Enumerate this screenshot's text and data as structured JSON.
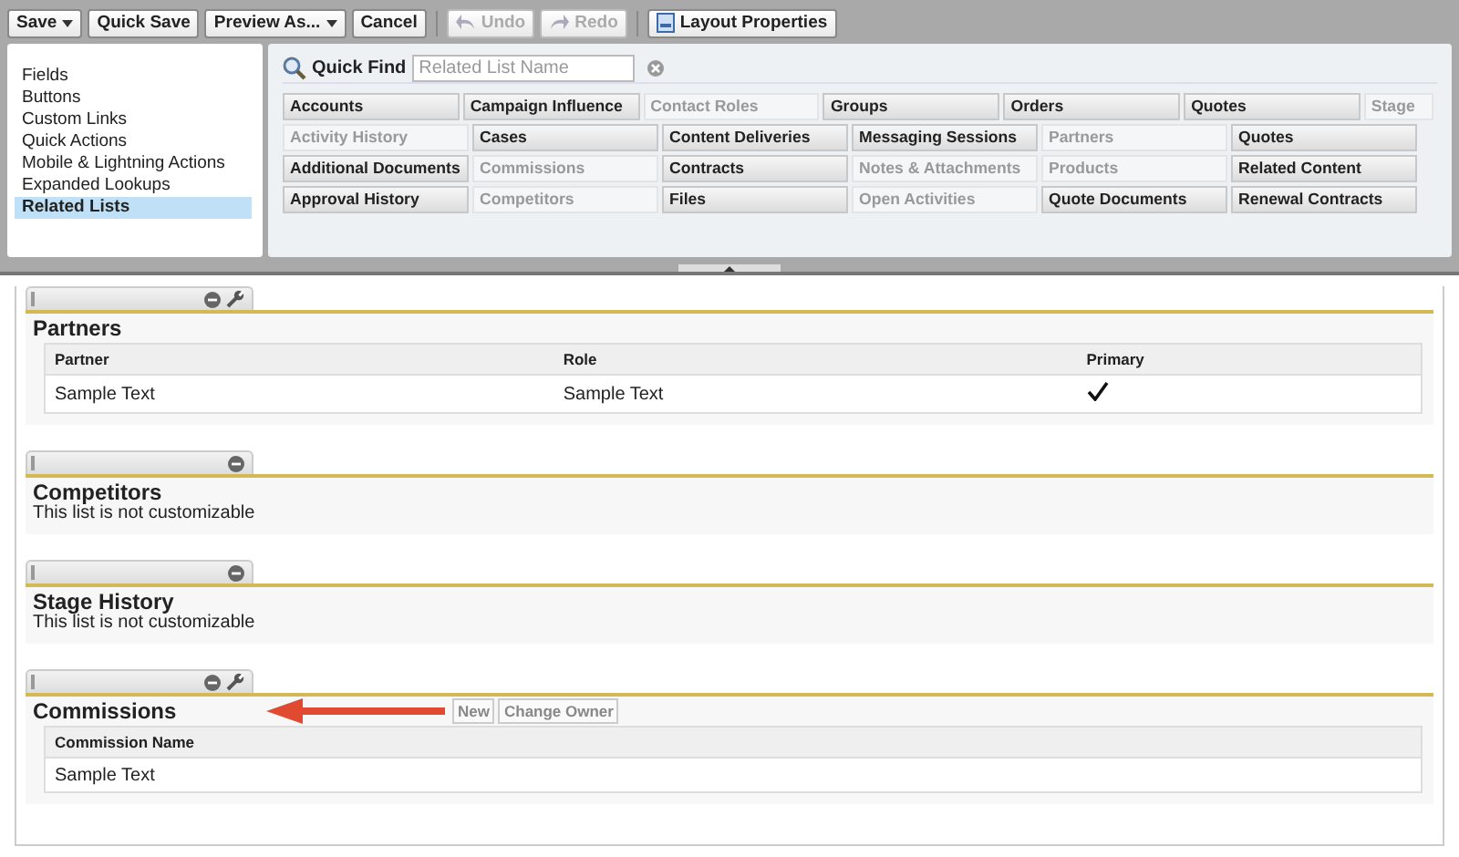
{
  "toolbar": {
    "buttons": [
      {
        "label": "Save",
        "kind": "dropdown",
        "disabled": false
      },
      {
        "label": "Quick Save",
        "kind": "plain",
        "disabled": false
      },
      {
        "label": "Preview As...",
        "kind": "dropdown",
        "disabled": false
      },
      {
        "label": "Cancel",
        "kind": "plain",
        "disabled": false
      },
      {
        "label": "Undo",
        "kind": "undo",
        "disabled": true
      },
      {
        "label": "Redo",
        "kind": "redo",
        "disabled": true
      },
      {
        "label": "Layout Properties",
        "kind": "properties",
        "disabled": false
      }
    ]
  },
  "sidebar": {
    "items": [
      {
        "label": "Fields",
        "selected": false
      },
      {
        "label": "Buttons",
        "selected": false
      },
      {
        "label": "Custom Links",
        "selected": false
      },
      {
        "label": "Quick Actions",
        "selected": false
      },
      {
        "label": "Mobile & Lightning Actions",
        "selected": false
      },
      {
        "label": "Expanded Lookups",
        "selected": false
      },
      {
        "label": "Related Lists",
        "selected": true
      }
    ]
  },
  "quick_find": {
    "label": "Quick Find",
    "placeholder": "Related List Name"
  },
  "palette": {
    "rows": [
      [
        {
          "label": "Accounts",
          "used": false
        },
        {
          "label": "Campaign Influence",
          "used": false
        },
        {
          "label": "Contact Roles",
          "used": true
        },
        {
          "label": "Groups",
          "used": false
        },
        {
          "label": "Orders",
          "used": false
        },
        {
          "label": "Quotes",
          "used": false
        },
        {
          "label": "Stage",
          "used": true
        }
      ],
      [
        {
          "label": "Activity History",
          "used": true
        },
        {
          "label": "Cases",
          "used": false
        },
        {
          "label": "Content Deliveries",
          "used": false
        },
        {
          "label": "Messaging Sessions",
          "used": false
        },
        {
          "label": "Partners",
          "used": true
        },
        {
          "label": "Quotes",
          "used": false
        }
      ],
      [
        {
          "label": "Additional Documents",
          "used": false
        },
        {
          "label": "Commissions",
          "used": true
        },
        {
          "label": "Contracts",
          "used": false
        },
        {
          "label": "Notes & Attachments",
          "used": true
        },
        {
          "label": "Products",
          "used": true
        },
        {
          "label": "Related Content",
          "used": false
        }
      ],
      [
        {
          "label": "Approval History",
          "used": false
        },
        {
          "label": "Competitors",
          "used": true
        },
        {
          "label": "Files",
          "used": false
        },
        {
          "label": "Open Activities",
          "used": true
        },
        {
          "label": "Quote Documents",
          "used": false
        },
        {
          "label": "Renewal Contracts",
          "used": false
        }
      ]
    ]
  },
  "sections": [
    {
      "title": "Partners",
      "editable": true,
      "columns": [
        "Partner",
        "Role",
        "Primary"
      ],
      "rows": [
        [
          {
            "kind": "text",
            "value": "Sample Text"
          },
          {
            "kind": "text",
            "value": "Sample Text"
          },
          {
            "kind": "check",
            "checked": true
          }
        ]
      ]
    },
    {
      "title": "Competitors",
      "editable": false,
      "note": "This list is not customizable"
    },
    {
      "title": "Stage History",
      "editable": false,
      "note": "This list is not customizable"
    },
    {
      "title": "Commissions",
      "editable": true,
      "buttons": [
        "New",
        "Change Owner"
      ],
      "arrow": true,
      "columns": [
        "Commission Name"
      ],
      "rows": [
        [
          {
            "kind": "text",
            "value": "Sample Text"
          }
        ]
      ]
    }
  ]
}
